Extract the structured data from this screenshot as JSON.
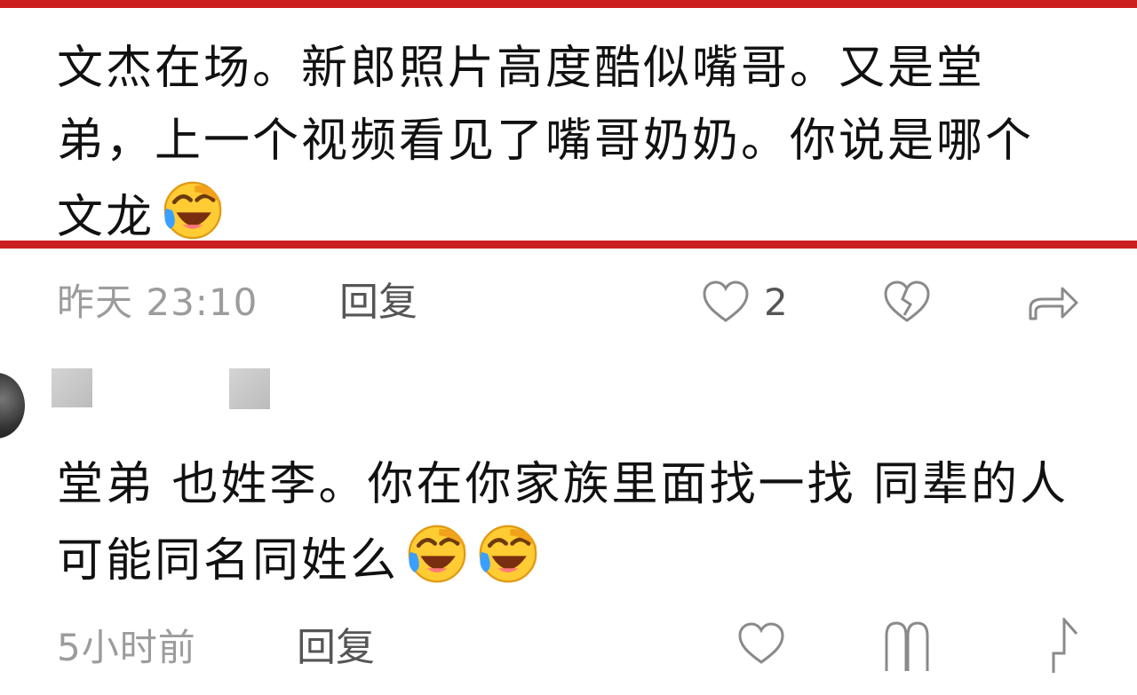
{
  "comments": [
    {
      "text": "文杰在场。新郎照片高度酷似嘴哥。又是堂弟，上一个视频看见了嘴哥奶奶。你说是哪个文龙",
      "emojis": [
        "face-with-tears-of-joy"
      ],
      "time": "昨天 23:10",
      "reply_label": "回复",
      "like_count": "2"
    },
    {
      "text": "堂弟 也姓李。你在你家族里面找一找 同辈的人可能同名同姓么",
      "emojis": [
        "face-with-tears-of-joy",
        "face-with-tears-of-joy"
      ],
      "time": "5小时前",
      "reply_label": "回复"
    }
  ],
  "colors": {
    "highlight_border": "#cc1f1f",
    "meta_text": "#9c9c9c",
    "icon_stroke": "#8a8a8a"
  }
}
